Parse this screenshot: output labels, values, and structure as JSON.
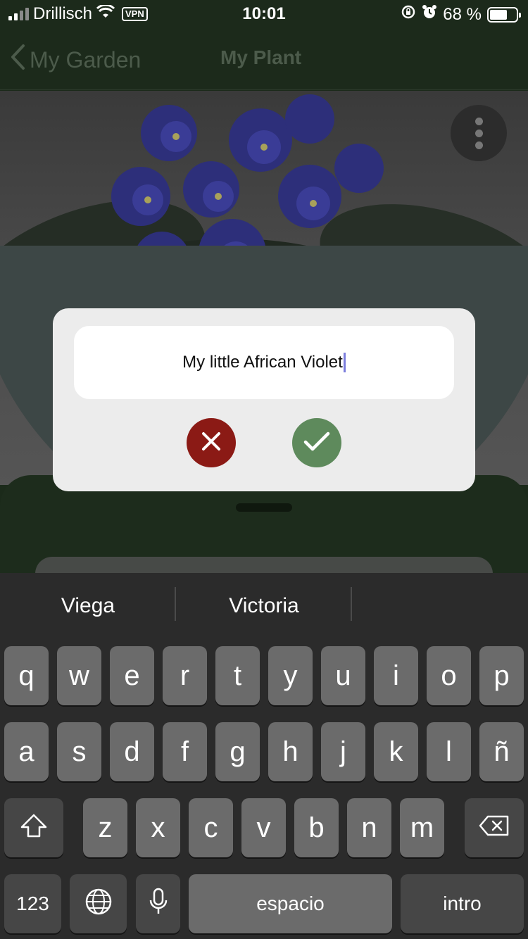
{
  "status_bar": {
    "carrier": "Drillisch",
    "vpn_label": "VPN",
    "time": "10:01",
    "battery_percent": "68 %",
    "battery_level": 0.68
  },
  "nav": {
    "back_label": "My Garden",
    "title": "My Plant"
  },
  "dialog": {
    "input_value": "My little African Violet"
  },
  "keyboard": {
    "suggestions": [
      "Viega",
      "Victoria"
    ],
    "row1": [
      "q",
      "w",
      "e",
      "r",
      "t",
      "y",
      "u",
      "i",
      "o",
      "p"
    ],
    "row2": [
      "a",
      "s",
      "d",
      "f",
      "g",
      "h",
      "j",
      "k",
      "l",
      "ñ"
    ],
    "row3": [
      "z",
      "x",
      "c",
      "v",
      "b",
      "n",
      "m"
    ],
    "numbers_label": "123",
    "space_label": "espacio",
    "return_label": "intro"
  },
  "colors": {
    "cancel": "#8b1a15",
    "confirm": "#5e8a5c",
    "nav_bg": "#1c2a1b"
  }
}
